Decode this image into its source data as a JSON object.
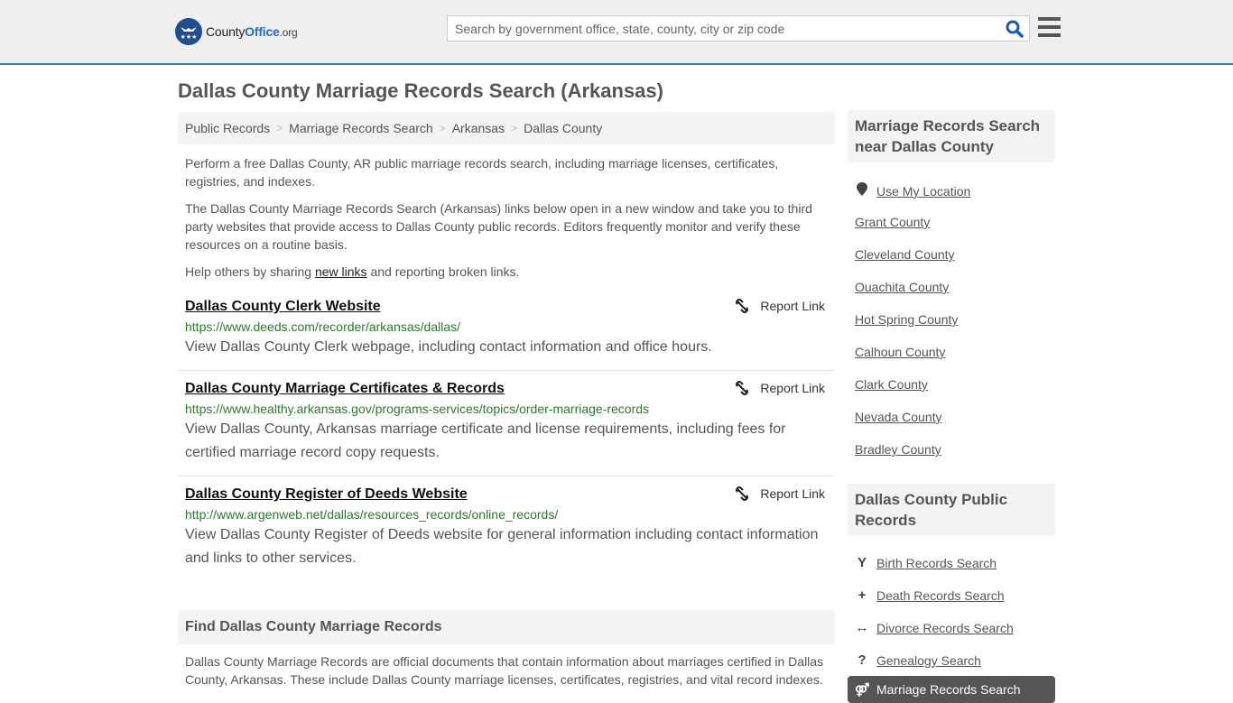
{
  "header": {
    "logo": {
      "county": "County",
      "office": "Office",
      "org": ".org"
    },
    "search": {
      "placeholder": "Search by government office, state, county, city or zip code",
      "value": ""
    },
    "accent_color": "#3a7cb0"
  },
  "page_title": "Dallas County Marriage Records Search (Arkansas)",
  "breadcrumb": [
    {
      "label": "Public Records"
    },
    {
      "label": "Marriage Records Search"
    },
    {
      "label": "Arkansas"
    },
    {
      "label": "Dallas County"
    }
  ],
  "intro": {
    "p1": "Perform a free Dallas County, AR public marriage records search, including marriage licenses, certificates, registries, and indexes.",
    "p2": "The Dallas County Marriage Records Search (Arkansas) links below open in a new window and take you to third party websites that provide access to Dallas County public records. Editors frequently monitor and verify these resources on a routine basis.",
    "p3_before": "Help others by sharing ",
    "p3_link": "new links",
    "p3_after": " and reporting broken links."
  },
  "results": [
    {
      "title": "Dallas County Clerk Website",
      "url": "https://www.deeds.com/recorder/arkansas/dallas/",
      "description": "View Dallas County Clerk webpage, including contact information and office hours.",
      "report_label": "Report Link"
    },
    {
      "title": "Dallas County Marriage Certificates & Records",
      "url": "https://www.healthy.arkansas.gov/programs-services/topics/order-marriage-records",
      "description": "View Dallas County, Arkansas marriage certificate and license requirements, including fees for certified marriage record copy requests.",
      "report_label": "Report Link"
    },
    {
      "title": "Dallas County Register of Deeds Website",
      "url": "http://www.argenweb.net/dallas/resources_records/online_records/",
      "description": "View Dallas County Register of Deeds website for general information including contact information and links to other services.",
      "report_label": "Report Link"
    }
  ],
  "find_section": {
    "heading": "Find Dallas County Marriage Records",
    "body": "Dallas County Marriage Records are official documents that contain information about marriages certified in Dallas County, Arkansas. These include Dallas County marriage licenses, certificates, registries, and vital record indexes."
  },
  "sidebar": {
    "nearby_heading": "Marriage Records Search near Dallas County",
    "use_location": "Use My Location",
    "nearby": [
      "Grant County",
      "Cleveland County",
      "Ouachita County",
      "Hot Spring County",
      "Calhoun County",
      "Clark County",
      "Nevada County",
      "Bradley County"
    ],
    "public_heading": "Dallas County Public Records",
    "public_links": [
      {
        "label": "Birth Records Search",
        "icon": "child-icon",
        "glyph": "Y"
      },
      {
        "label": "Death Records Search",
        "icon": "plus-icon",
        "glyph": "+"
      },
      {
        "label": "Divorce Records Search",
        "icon": "arrows-horizontal-icon",
        "glyph": "↔"
      },
      {
        "label": "Genealogy Search",
        "icon": "question-icon",
        "glyph": "?"
      }
    ],
    "active_link": {
      "label": "Marriage Records Search",
      "icon": "rings-icon",
      "glyph": "⚤"
    }
  }
}
